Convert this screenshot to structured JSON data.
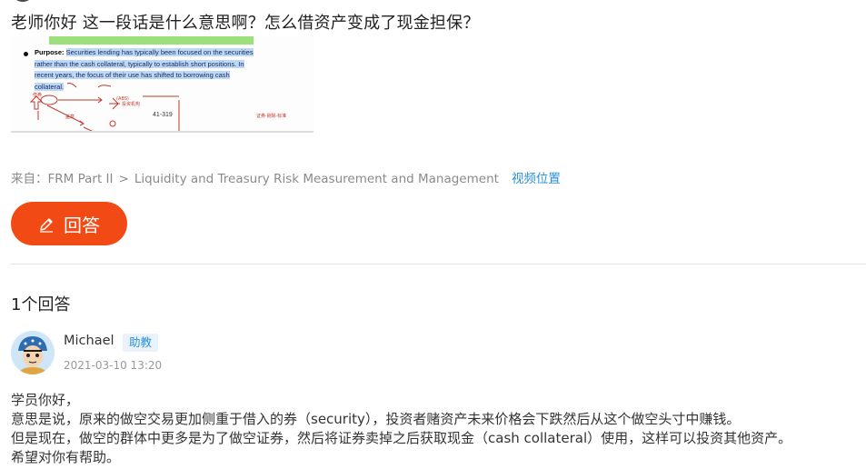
{
  "question": {
    "title": "老师你好 这一段话是什么意思啊？怎么借资产变成了现金担保？"
  },
  "attached_image": {
    "purpose_label": "Purpose:",
    "text_lines": [
      "Securities lending has typically been focused on the securities",
      "rather than the cash collateral, typically to establish short positions. In",
      "recent years, the focus of their use has shifted to borrowing cash",
      "collateral."
    ],
    "note_number": "41-319"
  },
  "source": {
    "prefix": "来自：",
    "course": "FRM Part II",
    "separator": ">",
    "chapter": "Liquidity and Treasury Risk Measurement and Management",
    "video_link": "视频位置"
  },
  "answer_button": {
    "label": "回答"
  },
  "answers_section": {
    "count_label": "1个回答"
  },
  "answer": {
    "user_name": "Michael",
    "role_badge": "助教",
    "timestamp": "2021-03-10 13:20",
    "body": [
      "学员你好，",
      "意思是说，原来的做空交易更加侧重于借入的券（security），投资者赌资产未来价格会下跌然后从这个做空头寸中赚钱。",
      "但是现在，做空的群体中更多是为了做空证券，然后将证券卖掉之后获取现金（cash collateral）使用，这样可以投资其他资产。",
      "希望对你有帮助。"
    ]
  },
  "colors": {
    "accent_orange": "#f24a14",
    "link_blue": "#2a8fd6"
  }
}
